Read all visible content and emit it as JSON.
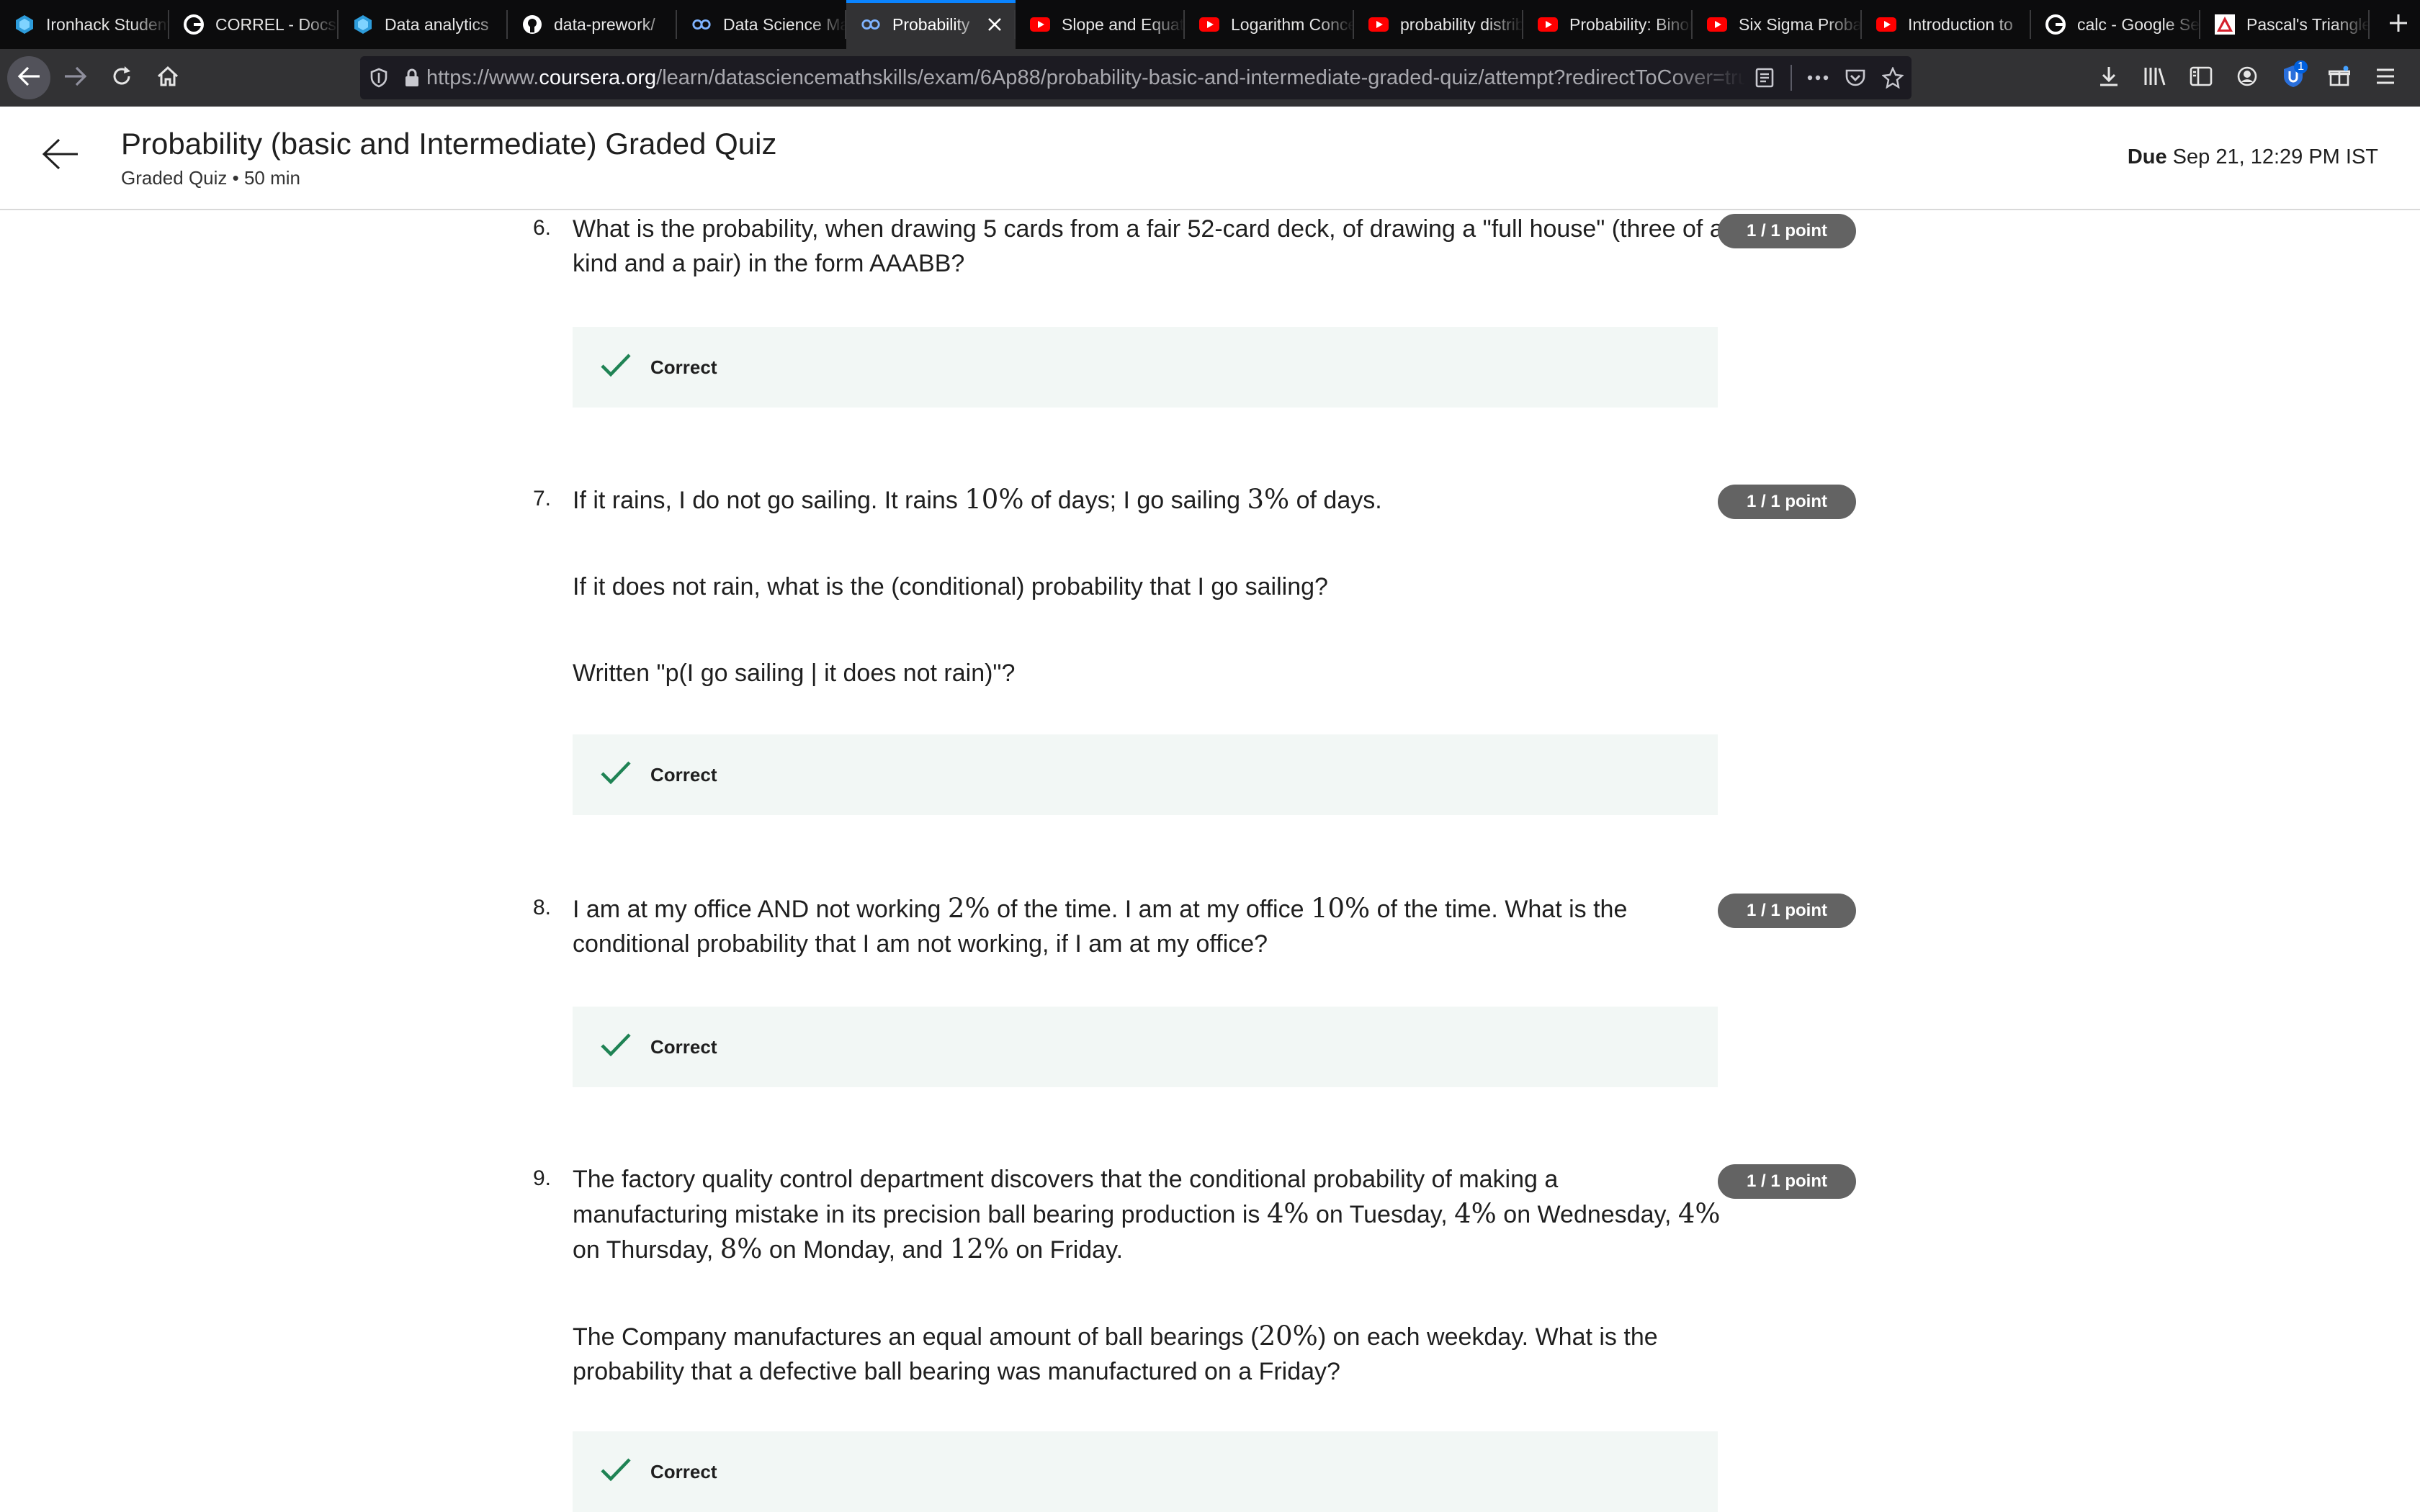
{
  "browser": {
    "tabs": [
      {
        "label": "Ironhack Student Portal",
        "icon": "ironhack-icon",
        "active": false
      },
      {
        "label": "CORREL - Docs Editors",
        "icon": "google-icon",
        "active": false
      },
      {
        "label": "Data analytics",
        "icon": "ironhack-icon",
        "active": false
      },
      {
        "label": "data-prework/",
        "icon": "github-icon",
        "active": false
      },
      {
        "label": "Data Science Math Skills",
        "icon": "coursera-icon",
        "active": false
      },
      {
        "label": "Probability",
        "icon": "coursera-icon",
        "active": true
      },
      {
        "label": "Slope and Equation",
        "icon": "youtube-icon",
        "active": false
      },
      {
        "label": "Logarithm Concepts",
        "icon": "youtube-icon",
        "active": false
      },
      {
        "label": "probability distribution",
        "icon": "youtube-icon",
        "active": false
      },
      {
        "label": "Probability: Binomial",
        "icon": "youtube-icon",
        "active": false
      },
      {
        "label": "Six Sigma Probability",
        "icon": "youtube-icon",
        "active": false
      },
      {
        "label": "Introduction to",
        "icon": "youtube-icon",
        "active": false
      },
      {
        "label": "calc - Google Search",
        "icon": "google-icon",
        "active": false
      },
      {
        "label": "Pascal's Triangle",
        "icon": "pascal-icon",
        "active": false
      }
    ],
    "url_host_prefix": "https://www.",
    "url_host": "coursera.org",
    "url_path": "/learn/datasciencemathskills/exam/6Ap88/probability-basic-and-intermediate-graded-quiz/attempt?redirectToCover=true",
    "extension_badge": "1"
  },
  "header": {
    "title": "Probability (basic and Intermediate) Graded Quiz",
    "subtitle": "Graded Quiz • 50 min",
    "due_label": "Due",
    "due_value": "Sep 21, 12:29 PM IST"
  },
  "questions": [
    {
      "number": "6.",
      "points": "1 / 1 point",
      "lines": [
        "What is the probability, when drawing 5 cards from a fair 52-card deck, of drawing a \"full house\" (three of a",
        "kind and a pair) in the form AAABB?"
      ],
      "feedback": "Correct"
    },
    {
      "number": "7.",
      "points": "1 / 1 point",
      "p1_a": "If it rains, I do not go sailing. It rains ",
      "p1_m1": "10%",
      "p1_b": " of days; I go sailing ",
      "p1_m2": "3%",
      "p1_c": " of days.",
      "p2": "If it does not rain, what is the (conditional) probability that I go sailing?",
      "p3": "Written \"p(I go sailing | it does not rain)\"?",
      "feedback": "Correct"
    },
    {
      "number": "8.",
      "points": "1 / 1 point",
      "l1_a": "I am at my office AND not working ",
      "l1_m1": "2%",
      "l1_b": " of the time. I am at my office ",
      "l1_m2": "10%",
      "l1_c": " of the time. What is the",
      "l2": "conditional probability that I am not working, if I am at my office?",
      "feedback": "Correct"
    },
    {
      "number": "9.",
      "points": "1 / 1 point",
      "l1": "The factory quality control department discovers that the conditional probability of making a",
      "l2_a": "manufacturing mistake in its precision ball bearing production is ",
      "l2_m1": "4%",
      "l2_b": " on Tuesday, ",
      "l2_m2": "4%",
      "l2_c": " on Wednesday, ",
      "l2_m3": "4%",
      "l3_a": "on Thursday, ",
      "l3_m1": "8%",
      "l3_b": " on Monday, and ",
      "l3_m2": "12%",
      "l3_c": " on Friday.",
      "p2_l1_a": "The Company manufactures an equal amount of ball bearings (",
      "p2_l1_m": "20%",
      "p2_l1_b": ") on each weekday. What is the",
      "p2_l2": "probability that a defective ball bearing was manufactured on a Friday?",
      "feedback": "Correct"
    }
  ],
  "colors": {
    "correct_green": "#1f8354",
    "feedback_bg": "#f2f7f5",
    "points_badge": "#636363",
    "tab_accent": "#0a84ff"
  }
}
